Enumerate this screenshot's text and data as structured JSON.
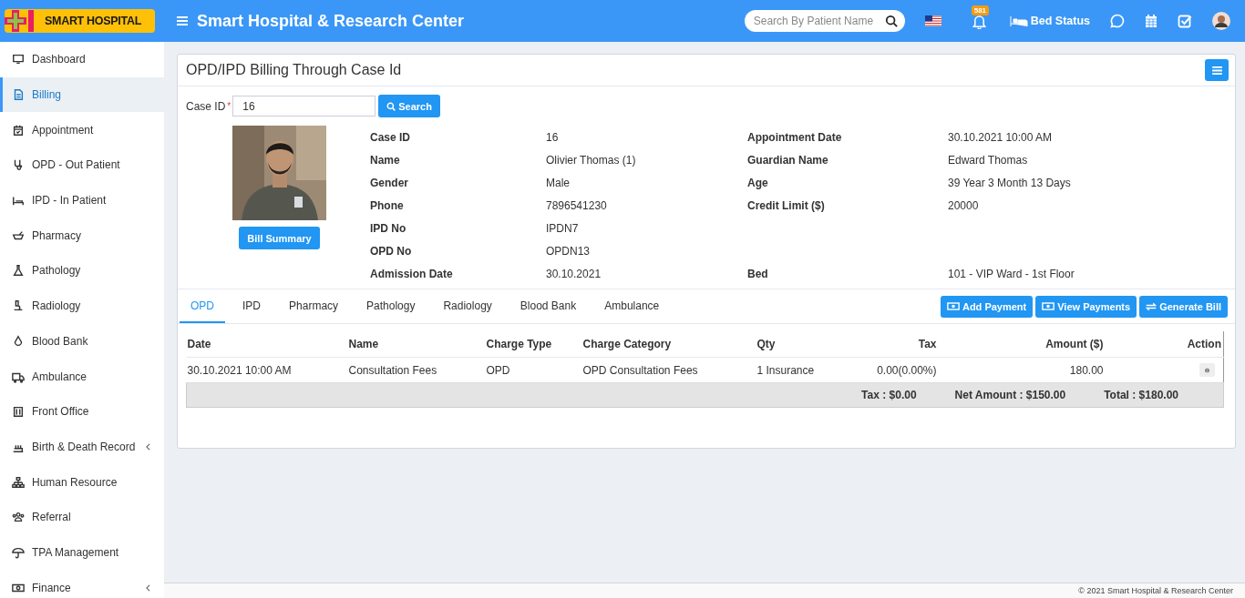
{
  "header": {
    "logo": "SMART HOSPITAL",
    "title": "Smart Hospital & Research Center",
    "search": {
      "placeholder": "Search By Patient Name"
    },
    "notification_count": "581",
    "bed_status": "Bed Status"
  },
  "sidebar": {
    "items": [
      {
        "label": "Dashboard",
        "selected": false,
        "submenu": false
      },
      {
        "label": "Billing",
        "selected": true,
        "submenu": false
      },
      {
        "label": "Appointment",
        "selected": false,
        "submenu": false
      },
      {
        "label": "OPD - Out Patient",
        "selected": false,
        "submenu": false
      },
      {
        "label": "IPD - In Patient",
        "selected": false,
        "submenu": false
      },
      {
        "label": "Pharmacy",
        "selected": false,
        "submenu": false
      },
      {
        "label": "Pathology",
        "selected": false,
        "submenu": false
      },
      {
        "label": "Radiology",
        "selected": false,
        "submenu": false
      },
      {
        "label": "Blood Bank",
        "selected": false,
        "submenu": false
      },
      {
        "label": "Ambulance",
        "selected": false,
        "submenu": false
      },
      {
        "label": "Front Office",
        "selected": false,
        "submenu": false
      },
      {
        "label": "Birth & Death Record",
        "selected": false,
        "submenu": true
      },
      {
        "label": "Human Resource",
        "selected": false,
        "submenu": false
      },
      {
        "label": "Referral",
        "selected": false,
        "submenu": false
      },
      {
        "label": "TPA Management",
        "selected": false,
        "submenu": false
      },
      {
        "label": "Finance",
        "selected": false,
        "submenu": true
      }
    ]
  },
  "panel": {
    "title": "OPD/IPD Billing Through Case Id",
    "case_field": {
      "label": "Case ID",
      "required_mark": "*",
      "value": "16",
      "button": "Search"
    },
    "photo": {
      "kind": "picture"
    },
    "bill_summary_button": "Bill Summary",
    "details": [
      [
        {
          "label": "Case ID",
          "value": "16"
        },
        {
          "label": "Appointment Date",
          "value": "30.10.2021 10:00 AM"
        }
      ],
      [
        {
          "label": "Name",
          "value": "Olivier Thomas (1)"
        },
        {
          "label": "Guardian Name",
          "value": "Edward Thomas"
        }
      ],
      [
        {
          "label": "Gender",
          "value": "Male"
        },
        {
          "label": "Age",
          "value": "39 Year 3 Month 13 Days"
        }
      ],
      [
        {
          "label": "Phone",
          "value": "7896541230"
        },
        {
          "label": "Credit Limit ($)",
          "value": "20000"
        }
      ],
      [
        {
          "label": "IPD No",
          "value": "IPDN7"
        }
      ],
      [
        {
          "label": "OPD No",
          "value": "OPDN13"
        }
      ],
      [
        {
          "label": "Admission Date",
          "value": "30.10.2021"
        },
        {
          "label": "Bed",
          "value": "101 - VIP Ward - 1st Floor"
        }
      ]
    ],
    "tabs": [
      {
        "label": "OPD",
        "selected": true
      },
      {
        "label": "IPD",
        "selected": false
      },
      {
        "label": "Pharmacy",
        "selected": false
      },
      {
        "label": "Pathology",
        "selected": false
      },
      {
        "label": "Radiology",
        "selected": false
      },
      {
        "label": "Blood Bank",
        "selected": false
      },
      {
        "label": "Ambulance",
        "selected": false
      }
    ],
    "actions": [
      "Add Payment",
      "View Payments",
      "Generate Bill"
    ],
    "table": {
      "columns": [
        "Date",
        "Name",
        "Charge Type",
        "Charge Category",
        "Qty",
        "Tax",
        "Amount ($)",
        "Action"
      ],
      "rows": [
        {
          "cells": [
            "30.10.2021 10:00 AM",
            "Consultation Fees",
            "OPD",
            "OPD Consultation Fees",
            "1 Insurance",
            "0.00(0.00%)",
            "180.00"
          ]
        }
      ],
      "totals": [
        "Tax : $0.00",
        "Net Amount : $150.00",
        "Total : $180.00"
      ]
    }
  },
  "footer": "© 2021 Smart Hospital & Research Center"
}
